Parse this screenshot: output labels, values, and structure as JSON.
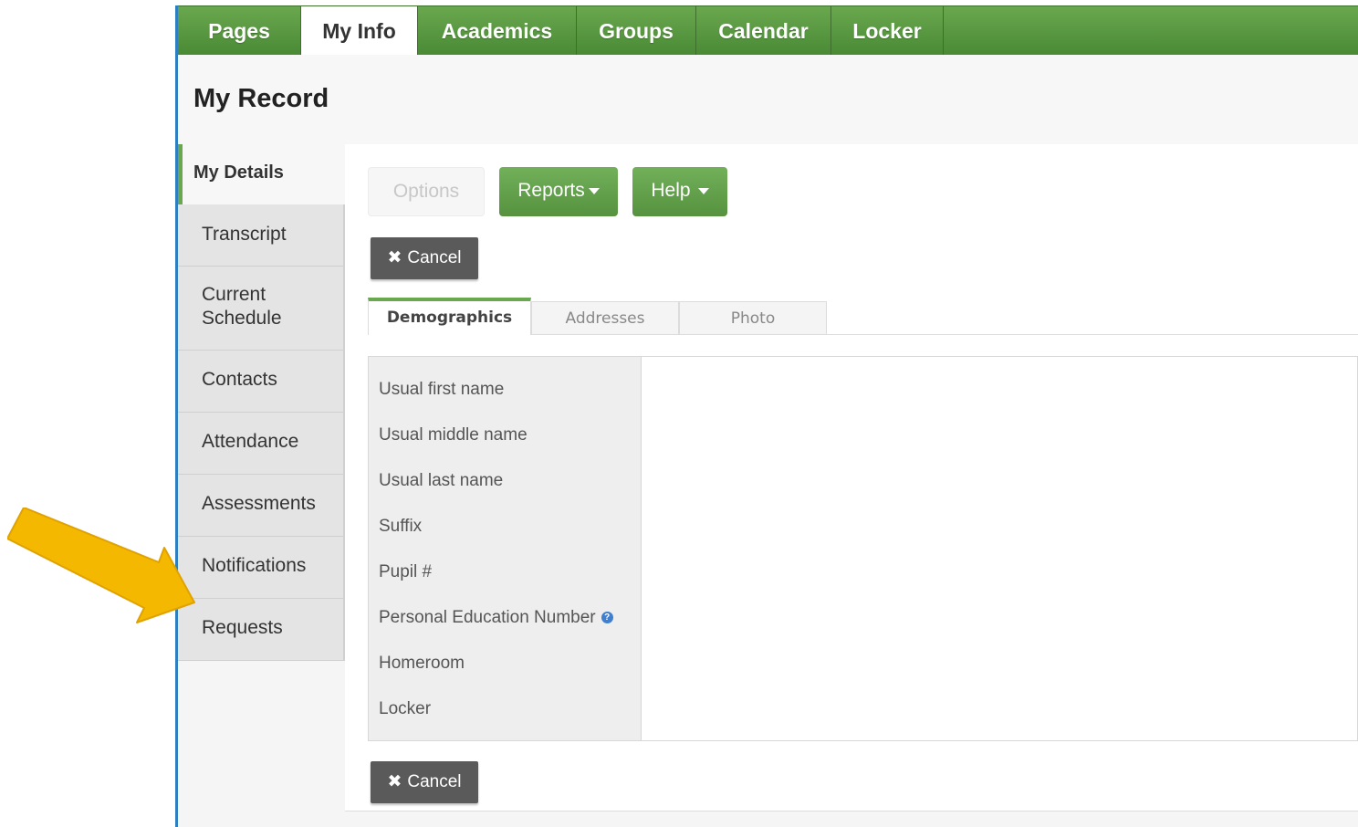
{
  "topnav": {
    "tabs": [
      {
        "label": "Pages"
      },
      {
        "label": "My Info"
      },
      {
        "label": "Academics"
      },
      {
        "label": "Groups"
      },
      {
        "label": "Calendar"
      },
      {
        "label": "Locker"
      }
    ],
    "active": "My Info"
  },
  "page": {
    "title": "My Record"
  },
  "sidebar": {
    "items": [
      {
        "label": "My Details"
      },
      {
        "label": "Transcript"
      },
      {
        "label": "Current Schedule"
      },
      {
        "label": "Contacts"
      },
      {
        "label": "Attendance"
      },
      {
        "label": "Assessments"
      },
      {
        "label": "Notifications"
      },
      {
        "label": "Requests"
      }
    ],
    "active": "My Details"
  },
  "toolbar": {
    "options_label": "Options",
    "reports_label": "Reports",
    "help_label": "Help",
    "cancel_label": "Cancel"
  },
  "subtabs": [
    {
      "label": "Demographics"
    },
    {
      "label": "Addresses"
    },
    {
      "label": "Photo"
    }
  ],
  "form": {
    "fields": [
      {
        "label": "Usual first name"
      },
      {
        "label": "Usual middle name"
      },
      {
        "label": "Usual last name"
      },
      {
        "label": "Suffix"
      },
      {
        "label": "Pupil #"
      },
      {
        "label": "Personal Education Number"
      },
      {
        "label": "Homeroom"
      },
      {
        "label": "Locker"
      }
    ]
  },
  "colors": {
    "nav_green": "#5a9a42",
    "accent_blue": "#2e7fc0",
    "arrow_yellow": "#f5b800"
  },
  "icons": {
    "cancel": "close-icon",
    "dropdown": "caret-down-icon",
    "help": "info-icon",
    "pointer": "arrow-icon"
  }
}
